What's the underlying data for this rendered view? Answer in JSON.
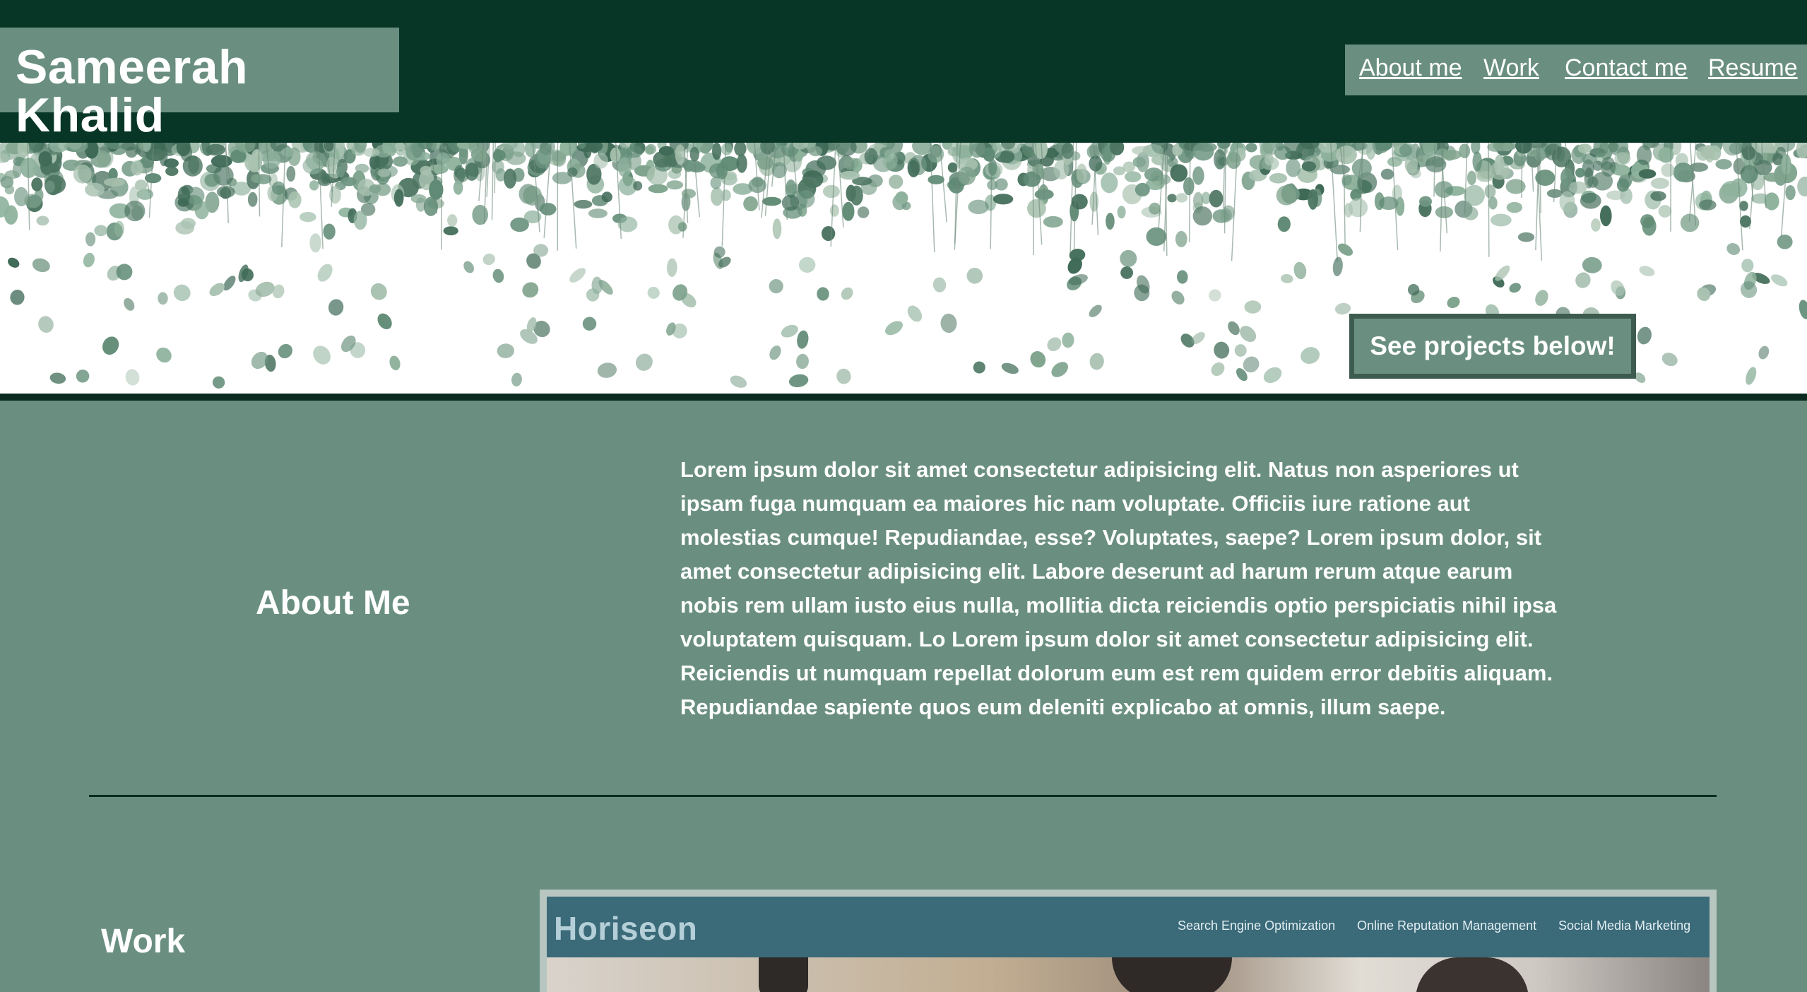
{
  "header": {
    "name": "Sameerah Khalid",
    "nav": [
      "About me",
      "Work",
      "Contact me",
      "Resume"
    ]
  },
  "hero": {
    "cta": "See projects below!"
  },
  "about": {
    "heading": "About Me",
    "text": "Lorem ipsum dolor sit amet consectetur adipisicing elit. Natus non asperiores ut ipsam fuga numquam ea maiores hic nam voluptate. Officiis iure ratione aut molestias cumque! Repudiandae, esse? Voluptates, saepe? Lorem ipsum dolor, sit amet consectetur adipisicing elit. Labore deserunt ad harum rerum atque earum nobis rem ullam iusto eius nulla, mollitia dicta reiciendis optio perspiciatis nihil ipsa voluptatem quisquam. Lo Lorem ipsum dolor sit amet consectetur adipisicing elit. Reiciendis ut numquam repellat dolorum eum est rem quidem error debitis aliquam. Repudiandae sapiente quos eum deleniti explicabo at omnis, illum saepe."
  },
  "work": {
    "heading": "Work",
    "project": {
      "logo": "Horiseon",
      "nav": [
        "Search Engine Optimization",
        "Online Reputation Management",
        "Social Media Marketing"
      ]
    }
  },
  "colors": {
    "header_bg": "#073627",
    "accent_green": "#6a8f81",
    "dark_border": "#3d5c4f",
    "divider": "#0b2a20",
    "horiseon_blue": "#3b6a79"
  }
}
